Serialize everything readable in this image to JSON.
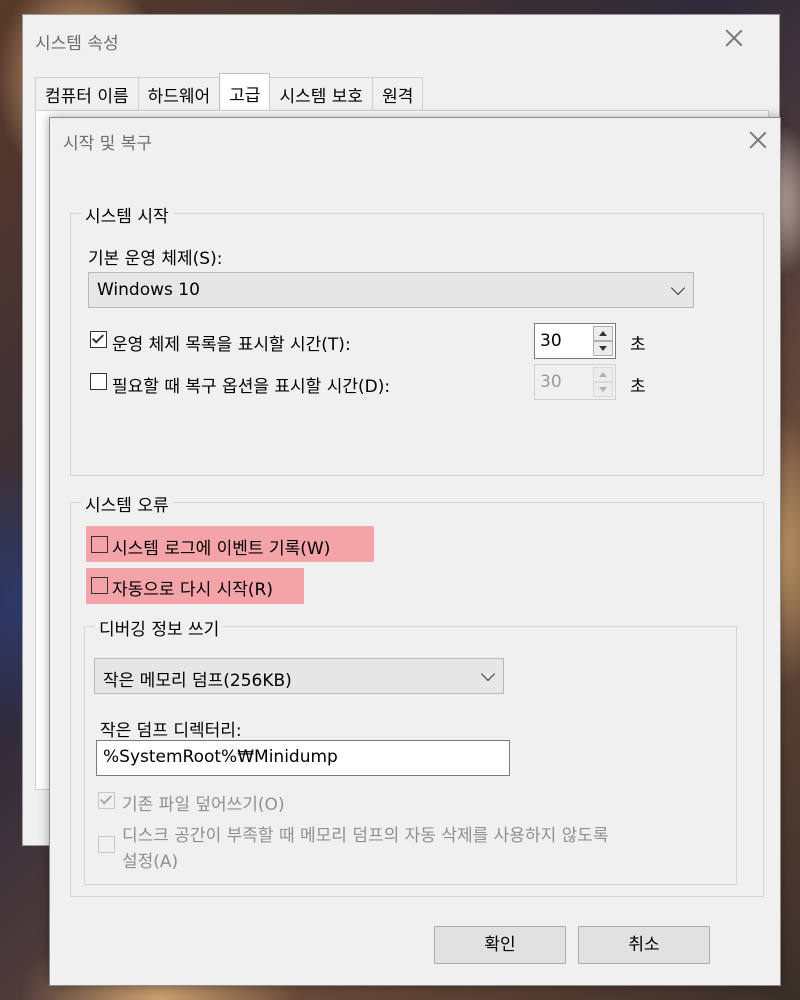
{
  "parent_dialog": {
    "title": "시스템 속성",
    "tabs": [
      {
        "label": "컴퓨터 이름"
      },
      {
        "label": "하드웨어"
      },
      {
        "label": "고급"
      },
      {
        "label": "시스템 보호"
      },
      {
        "label": "원격"
      }
    ],
    "active_tab": "고급"
  },
  "dialog": {
    "title": "시작 및 복구",
    "system_startup": {
      "group_label": "시스템 시작",
      "default_os_label": "기본 운영 체제(S):",
      "default_os_value": "Windows 10",
      "show_os_list": {
        "label": "운영 체제 목록을 표시할 시간(T):",
        "checked": true,
        "value": "30",
        "unit": "초"
      },
      "show_recovery": {
        "label": "필요할 때 복구 옵션을 표시할 시간(D):",
        "checked": false,
        "value": "30",
        "unit": "초"
      }
    },
    "system_failure": {
      "group_label": "시스템 오류",
      "write_event": {
        "label": "시스템 로그에 이벤트 기록(W)",
        "checked": false
      },
      "auto_restart": {
        "label": "자동으로 다시 시작(R)",
        "checked": false
      },
      "highlight_color": "#f4a3a8",
      "debug": {
        "group_label": "디버깅 정보 쓰기",
        "dump_type": "작은 메모리 덤프(256KB)",
        "dump_dir_label": "작은 덤프 디렉터리:",
        "dump_dir_value": "%SystemRoot%₩Minidump",
        "overwrite": {
          "label": "기존 파일 덮어쓰기(O)",
          "checked": true
        },
        "disable_auto_delete": {
          "label_line1": "디스크 공간이 부족할 때 메모리 덤프의 자동 삭제를 사용하지 않도록",
          "label_line2": "설정(A)",
          "checked": false
        }
      }
    },
    "buttons": {
      "ok": "확인",
      "cancel": "취소"
    }
  }
}
